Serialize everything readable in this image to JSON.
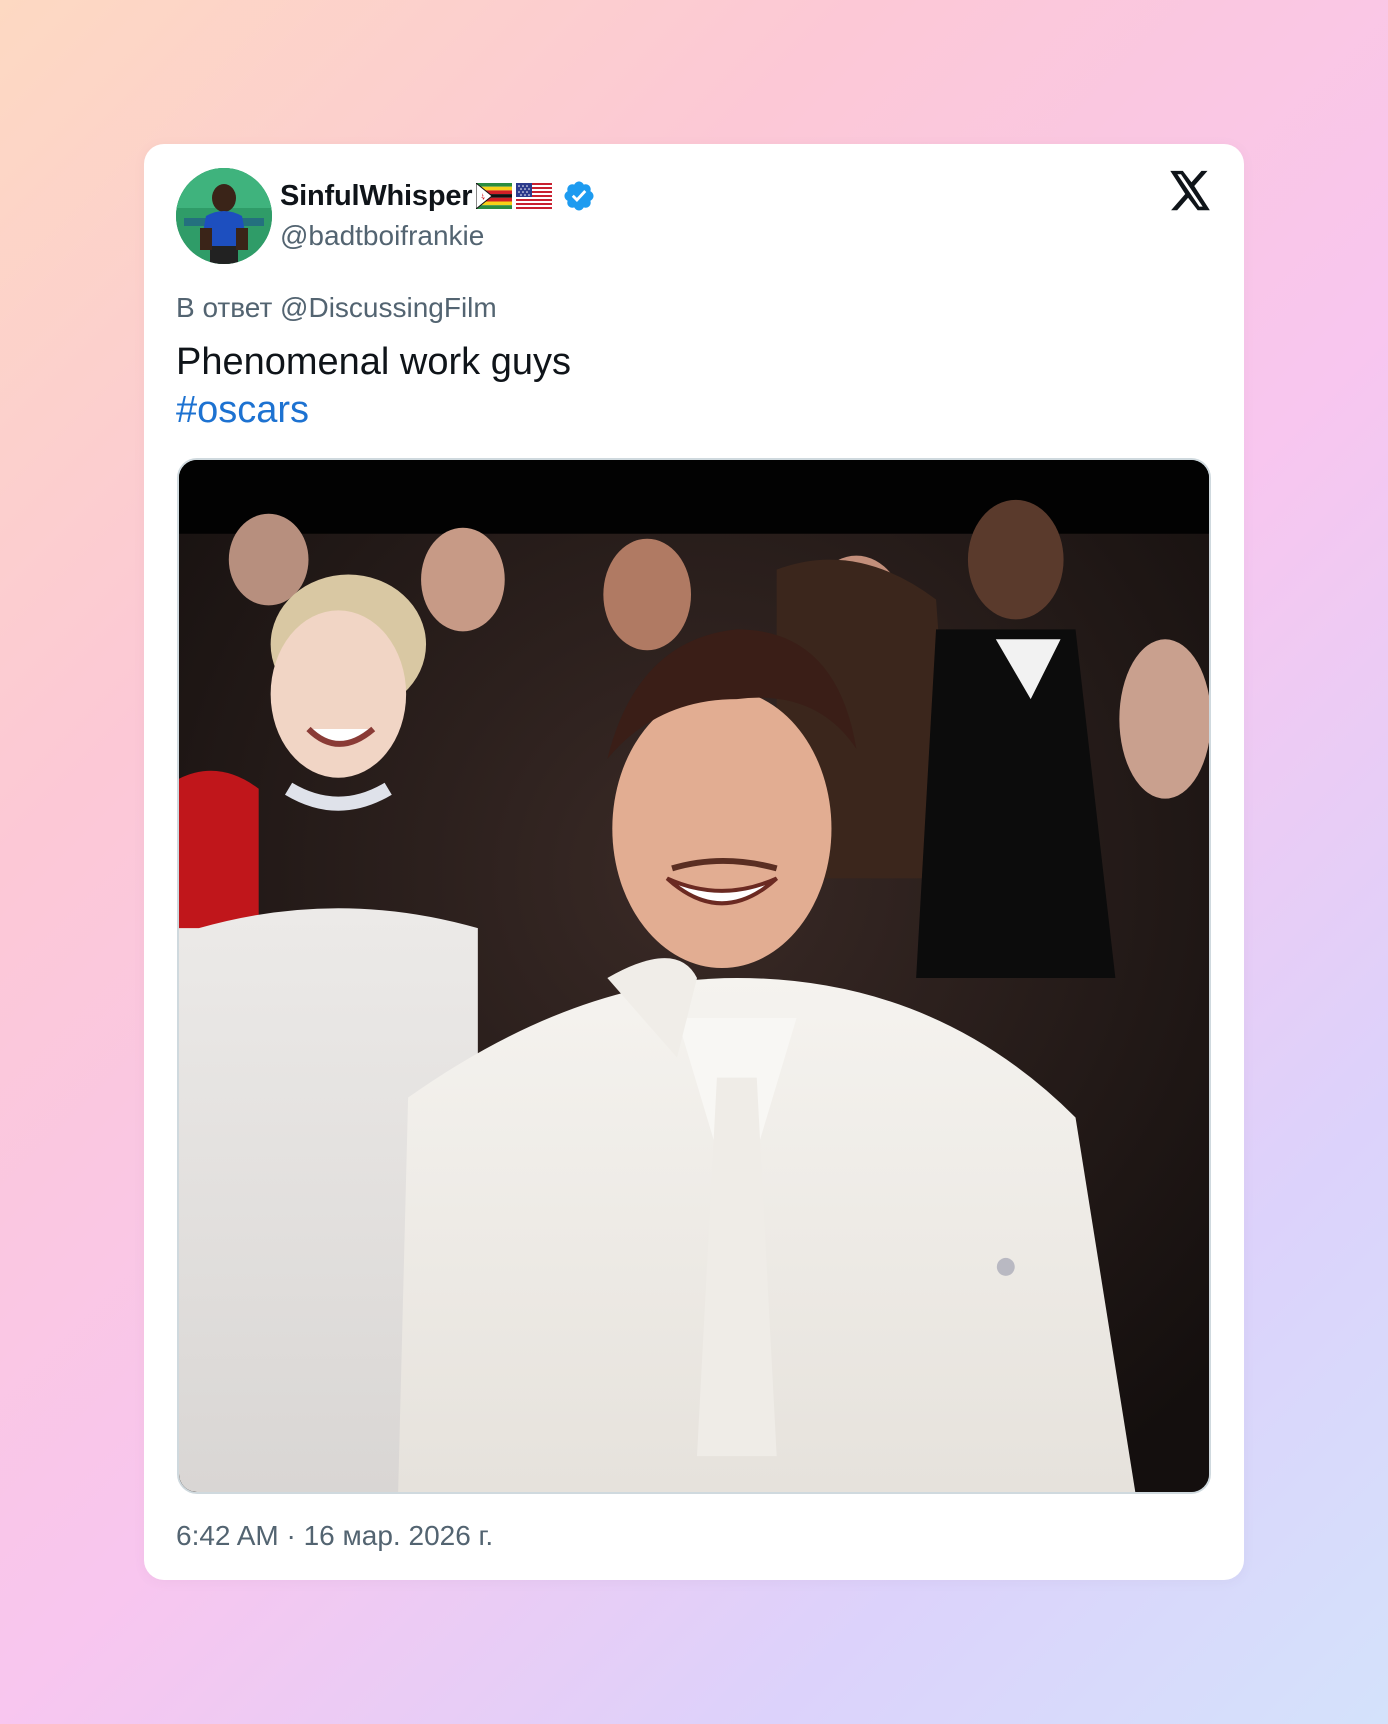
{
  "page": {
    "background_colors": [
      "#fdd9c2",
      "#fcc8d6",
      "#f8c6ef",
      "#dcd2fb",
      "#d4e2fb"
    ]
  },
  "tweet": {
    "author": {
      "display_name": "SinfulWhisper",
      "flags": [
        "zimbabwe-flag-icon",
        "usa-flag-icon"
      ],
      "verified": true,
      "verified_color": "#1d9bf0",
      "handle": "@badtboifrankie",
      "avatar_icon": "avatar-photo"
    },
    "platform_icon": "x-logo-icon",
    "reply_to": "В ответ @DiscussingFilm",
    "text": "Phenomenal work guys",
    "hashtag": "#oscars",
    "hashtag_color": "#1d72d1",
    "media": {
      "type": "photo"
    },
    "timestamp": "6:42 AM · 16 мар. 2026 г."
  }
}
